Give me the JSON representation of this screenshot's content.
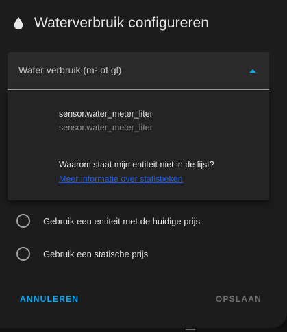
{
  "dialog": {
    "title": "Waterverbruik configureren",
    "icon": "water-drop-icon"
  },
  "select": {
    "label": "Water verbruik (m³ of gl)",
    "accent_color": "#03a9f4"
  },
  "menu": {
    "item_primary": "sensor.water_meter_liter",
    "item_secondary": "sensor.water_meter_liter",
    "help_question": "Waarom staat mijn entiteit niet in de lijst?",
    "help_link": "Meer informatie over statistieken"
  },
  "radios": [
    {
      "label": "Gebruik een entiteit met de huidige prijs",
      "checked": false
    },
    {
      "label": "Gebruik een statische prijs",
      "checked": false
    }
  ],
  "actions": {
    "cancel": "ANNULEREN",
    "save": "OPSLAAN"
  }
}
